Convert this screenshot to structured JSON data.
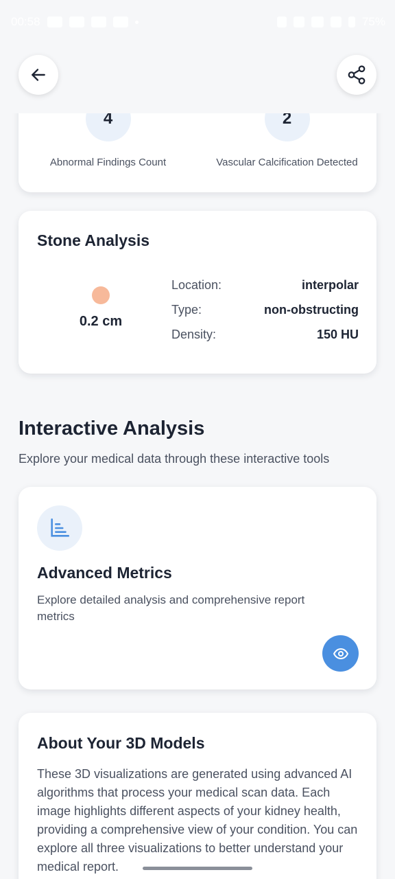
{
  "status_bar": {
    "time": "00:58",
    "battery": "75%"
  },
  "header": {
    "back_icon": "arrow-left-icon",
    "share_icon": "share-icon"
  },
  "findings": [
    {
      "count": "4",
      "label": "Abnormal Findings Count"
    },
    {
      "count": "2",
      "label": "Vascular Calcification Detected"
    }
  ],
  "stone_analysis": {
    "title": "Stone Analysis",
    "size": "0.2 cm",
    "dot_color": "#f7b99a",
    "rows": [
      {
        "key": "Location:",
        "value": "interpolar"
      },
      {
        "key": "Type:",
        "value": "non-obstructing"
      },
      {
        "key": "Density:",
        "value": "150 HU"
      }
    ]
  },
  "interactive": {
    "title": "Interactive Analysis",
    "subtitle": "Explore your medical data through these interactive tools",
    "metrics": {
      "icon": "bar-chart-icon",
      "title": "Advanced Metrics",
      "description": "Explore detailed analysis and comprehensive report metrics",
      "button_icon": "eye-icon",
      "accent": "#4a8fe0"
    }
  },
  "about": {
    "title": "About Your 3D Models",
    "text": "These 3D visualizations are generated using advanced AI algorithms that process your medical scan data. Each image highlights different aspects of your kidney health, providing a comprehensive view of your condition. You can explore all three visualizations to better understand your medical report."
  }
}
